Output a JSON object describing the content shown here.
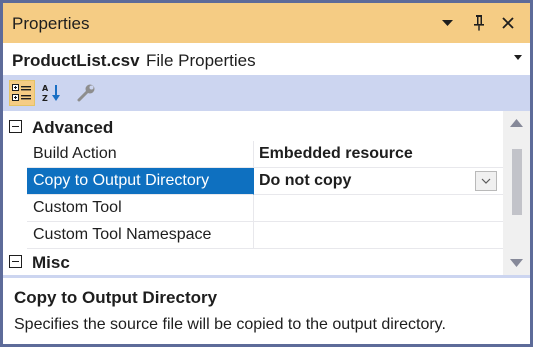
{
  "window": {
    "title": "Properties"
  },
  "object_selector": {
    "name": "ProductList.csv",
    "type": "File Properties"
  },
  "categories": [
    {
      "label": "Advanced",
      "properties": [
        {
          "name": "Build Action",
          "value": "Embedded resource"
        },
        {
          "name": "Copy to Output Directory",
          "value": "Do not copy"
        },
        {
          "name": "Custom Tool",
          "value": ""
        },
        {
          "name": "Custom Tool Namespace",
          "value": ""
        }
      ]
    },
    {
      "label": "Misc",
      "properties": []
    }
  ],
  "description": {
    "title": "Copy to Output Directory",
    "text": "Specifies the source file will be copied to the output directory."
  },
  "colors": {
    "frame": "#5d6b99",
    "title_bar": "#f5cc84",
    "toolbar": "#ccd5f0",
    "selection": "#0e70c0"
  },
  "icons": {
    "dropdown": "triangle-down-icon",
    "pin": "pin-icon",
    "close": "close-icon",
    "categorized": "categorized-icon",
    "alphabetical": "sort-alphabetical-icon",
    "property_pages": "wrench-icon"
  }
}
